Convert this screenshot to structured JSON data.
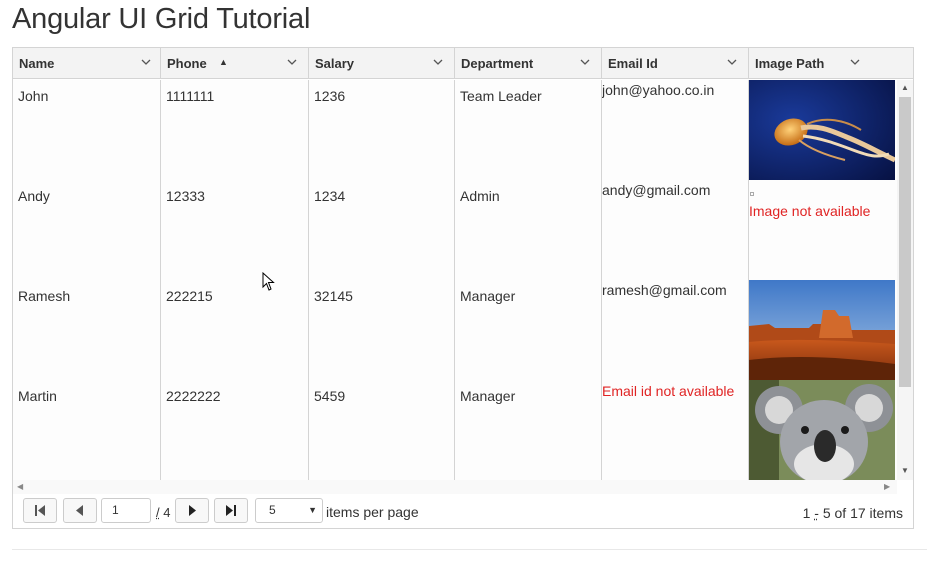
{
  "page": {
    "title": "Angular UI Grid Tutorial"
  },
  "grid": {
    "columns": [
      {
        "label": "Name"
      },
      {
        "label": "Phone"
      },
      {
        "label": "Salary"
      },
      {
        "label": "Department"
      },
      {
        "label": "Email Id"
      },
      {
        "label": "Image Path"
      }
    ],
    "sort": {
      "column": "Phone",
      "direction": "ascending",
      "icon": "sort-asc-icon"
    },
    "rows": [
      {
        "name": "John",
        "phone": "1111111",
        "salary": "1236",
        "department": "Team Leader",
        "email": "john@yahoo.co.in",
        "image": "jellyfish"
      },
      {
        "name": "Andy",
        "phone": "12333",
        "salary": "1234",
        "department": "Admin",
        "email": "andy@gmail.com",
        "image_text": "Image not available"
      },
      {
        "name": "Ramesh",
        "phone": "222215",
        "salary": "32145",
        "department": "Manager",
        "email": "ramesh@gmail.com",
        "image": "desert"
      },
      {
        "name": "Martin",
        "phone": "2222222",
        "salary": "5459",
        "department": "Manager",
        "email_text": "Email id not available",
        "image": "koala"
      }
    ]
  },
  "pager": {
    "current_page": "1",
    "separator": "/",
    "total_pages": "4",
    "page_size": "5",
    "items_per_page_label": "items per page",
    "count_start": "1",
    "count_dash": "-",
    "count_rest": "5 of 17 items"
  },
  "colors": {
    "error_text": "#e02424",
    "header_bg": "#f3f3f3",
    "border": "#d4d4d4"
  }
}
